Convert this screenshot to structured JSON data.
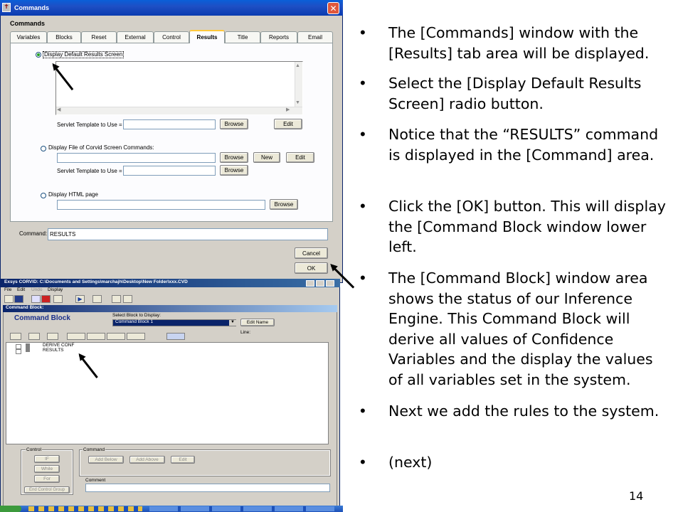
{
  "commands_window": {
    "title": "Commands",
    "heading": "Commands",
    "tabs": [
      "Variables",
      "Blocks",
      "Reset",
      "External",
      "Control",
      "Results",
      "Title",
      "Reports",
      "Email"
    ],
    "active_tab": "Results",
    "results_tab": {
      "opt_default": "Display Default Results Screen",
      "servlet_label": "Servlet Template to Use =",
      "browse": "Browse",
      "edit": "Edit",
      "opt_corvid": "Display File of Corvid Screen Commands:",
      "new": "New",
      "opt_html": "Display HTML page"
    },
    "command_label": "Command:",
    "command_value": "RESULTS",
    "cancel": "Cancel",
    "ok": "OK"
  },
  "corvid_window": {
    "title": "Exsys CORVID: C:\\Documents and Settings\\marchajh\\Desktop\\New Folder\\xxx.CVD",
    "menu": [
      "File",
      "Edit",
      "Undo",
      "Display"
    ],
    "panel_title": "Command Block:",
    "heading": "Command Block",
    "select_label": "Select Block to Display:",
    "select_value": "Command Block 1",
    "edit_name": "Edit Name",
    "line_label": "Line:",
    "tree": [
      "DERIVE CONF",
      "RESULTS"
    ],
    "control_label": "Control",
    "control_buttons": [
      "IF",
      "While",
      "For"
    ],
    "end_control": "End Control Group",
    "command_label": "Command",
    "command_buttons": [
      "Add Below",
      "Add Above",
      "Edit"
    ],
    "comment_label": "Comment"
  },
  "bullets": [
    "The [Commands] window with the [Results] tab area will be displayed.",
    "Select the [Display Default Results Screen] radio button.",
    "Notice that the “RESULTS” command is displayed in the [Command] area.",
    "Click the [OK] button.  This will display the [Command Block window lower left.",
    "The [Command Block] window area shows the status of our Inference Engine.  This Command Block will derive all values of Confidence Variables and the display the values of all variables set in the system.",
    "Next we add the rules to the system.",
    "(next)"
  ],
  "bullet_mark": "•",
  "page_number": "14",
  "colors": {
    "titlebar": "#0a3bb0",
    "dialog": "#d4d0c8",
    "tab_active_accent": "#ffc83c",
    "text": "#000000"
  }
}
